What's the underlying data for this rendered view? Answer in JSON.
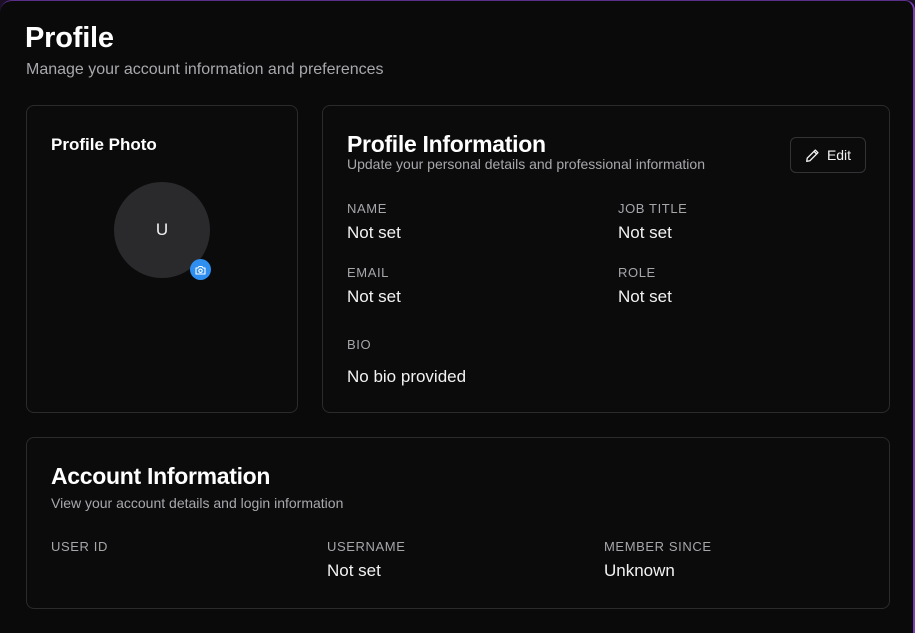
{
  "header": {
    "title": "Profile",
    "subtitle": "Manage your account information and preferences"
  },
  "photo_card": {
    "title": "Profile Photo",
    "avatar_initial": "U",
    "camera_icon": "camera-icon",
    "accent": "#2f8ff0"
  },
  "info_card": {
    "title": "Profile Information",
    "subtitle": "Update your personal details and professional information",
    "edit_label": "Edit",
    "edit_icon": "pencil-icon",
    "fields": {
      "name_label": "NAME",
      "name_value": "Not set",
      "job_title_label": "JOB TITLE",
      "job_title_value": "Not set",
      "email_label": "EMAIL",
      "email_value": "Not set",
      "role_label": "ROLE",
      "role_value": "Not set",
      "bio_label": "BIO",
      "bio_value": "No bio provided"
    }
  },
  "account_card": {
    "title": "Account Information",
    "subtitle": "View your account details and login information",
    "fields": {
      "user_id_label": "USER ID",
      "user_id_value": "",
      "username_label": "USERNAME",
      "username_value": "Not set",
      "member_since_label": "MEMBER SINCE",
      "member_since_value": "Unknown"
    }
  }
}
